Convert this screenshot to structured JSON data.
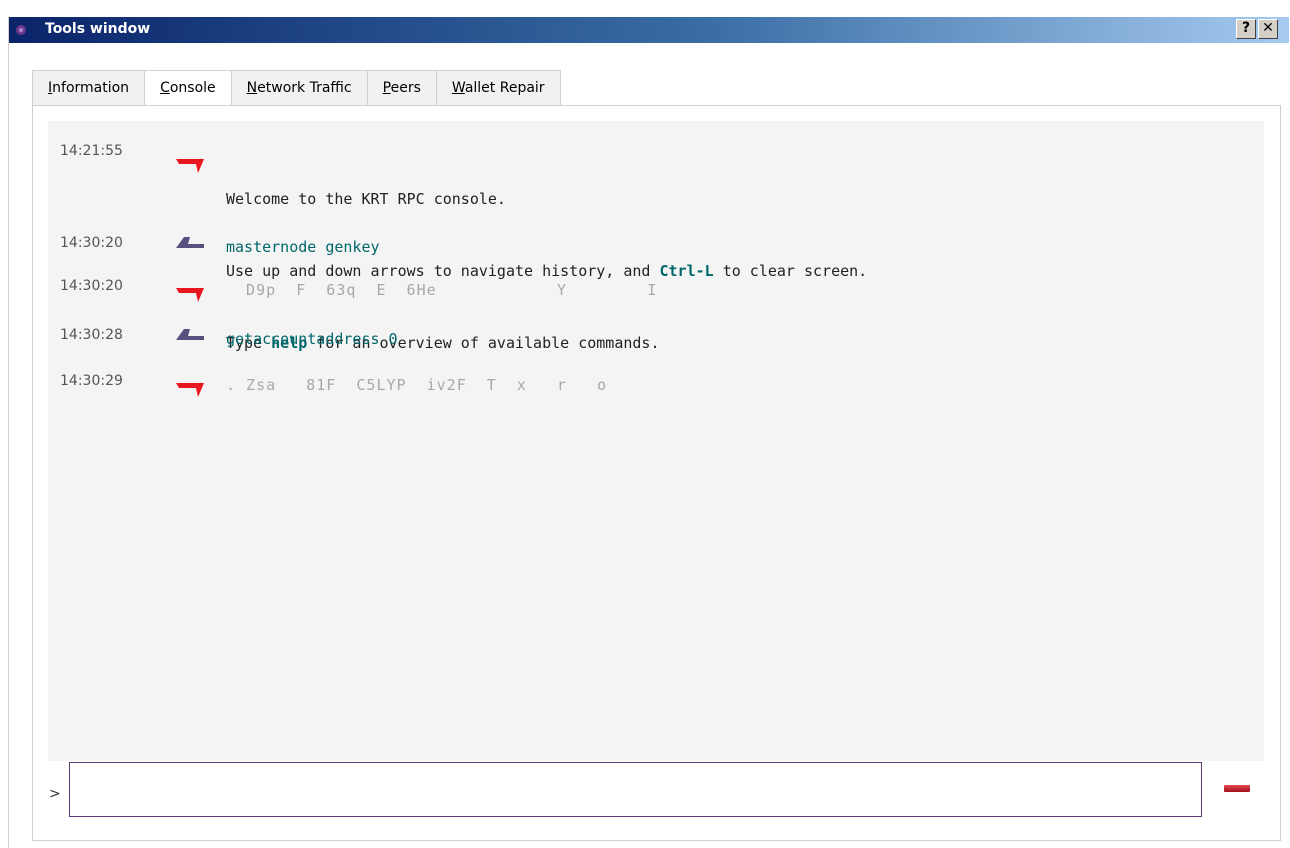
{
  "window": {
    "title": "Tools window",
    "help_button": "?",
    "close_button": "✕"
  },
  "tabs": [
    {
      "label_u": "I",
      "label_rest": "nformation",
      "active": false
    },
    {
      "label_u": "C",
      "label_rest": "onsole",
      "active": true
    },
    {
      "label_u": "N",
      "label_rest": "etwork Traffic",
      "active": false
    },
    {
      "label_u": "P",
      "label_rest": "eers",
      "active": false
    },
    {
      "label_u": "W",
      "label_rest": "allet Repair",
      "active": false
    }
  ],
  "console": {
    "messages": [
      {
        "time": "14:21:55",
        "direction": "reply",
        "line1": "Welcome to the KRT RPC console.",
        "line2_pre": "Use up and down arrows to navigate history, and ",
        "line2_kw": "Ctrl-L",
        "line2_post": " to clear screen.",
        "line3_pre": "Type ",
        "line3_kw": "help",
        "line3_post": " for an overview of available commands."
      },
      {
        "time": "14:30:20",
        "direction": "request",
        "text": "masternode genkey"
      },
      {
        "time": "14:30:20",
        "direction": "reply",
        "text": "  D9p  F  63q  E  6He            Y        I"
      },
      {
        "time": "14:30:28",
        "direction": "request",
        "text": "getaccountaddress 0"
      },
      {
        "time": "14:30:29",
        "direction": "reply",
        "text": ". Zsa   81F  C5LYP  iv2F  T  x   r   o"
      }
    ],
    "prompt_label": ">",
    "input_value": "",
    "input_placeholder": ""
  },
  "colors": {
    "title_gradient_start": "#0a246a",
    "title_gradient_end": "#a6caf0",
    "reply_arrow": "#e8141e",
    "request_arrow": "#5a5080",
    "command_text": "#00676b",
    "clear_button": "#c0202a"
  },
  "icons": {
    "title": "app-logo-icon",
    "reply": "reply-arrow-icon",
    "request": "request-arrow-icon",
    "clear": "clear-console-icon"
  }
}
